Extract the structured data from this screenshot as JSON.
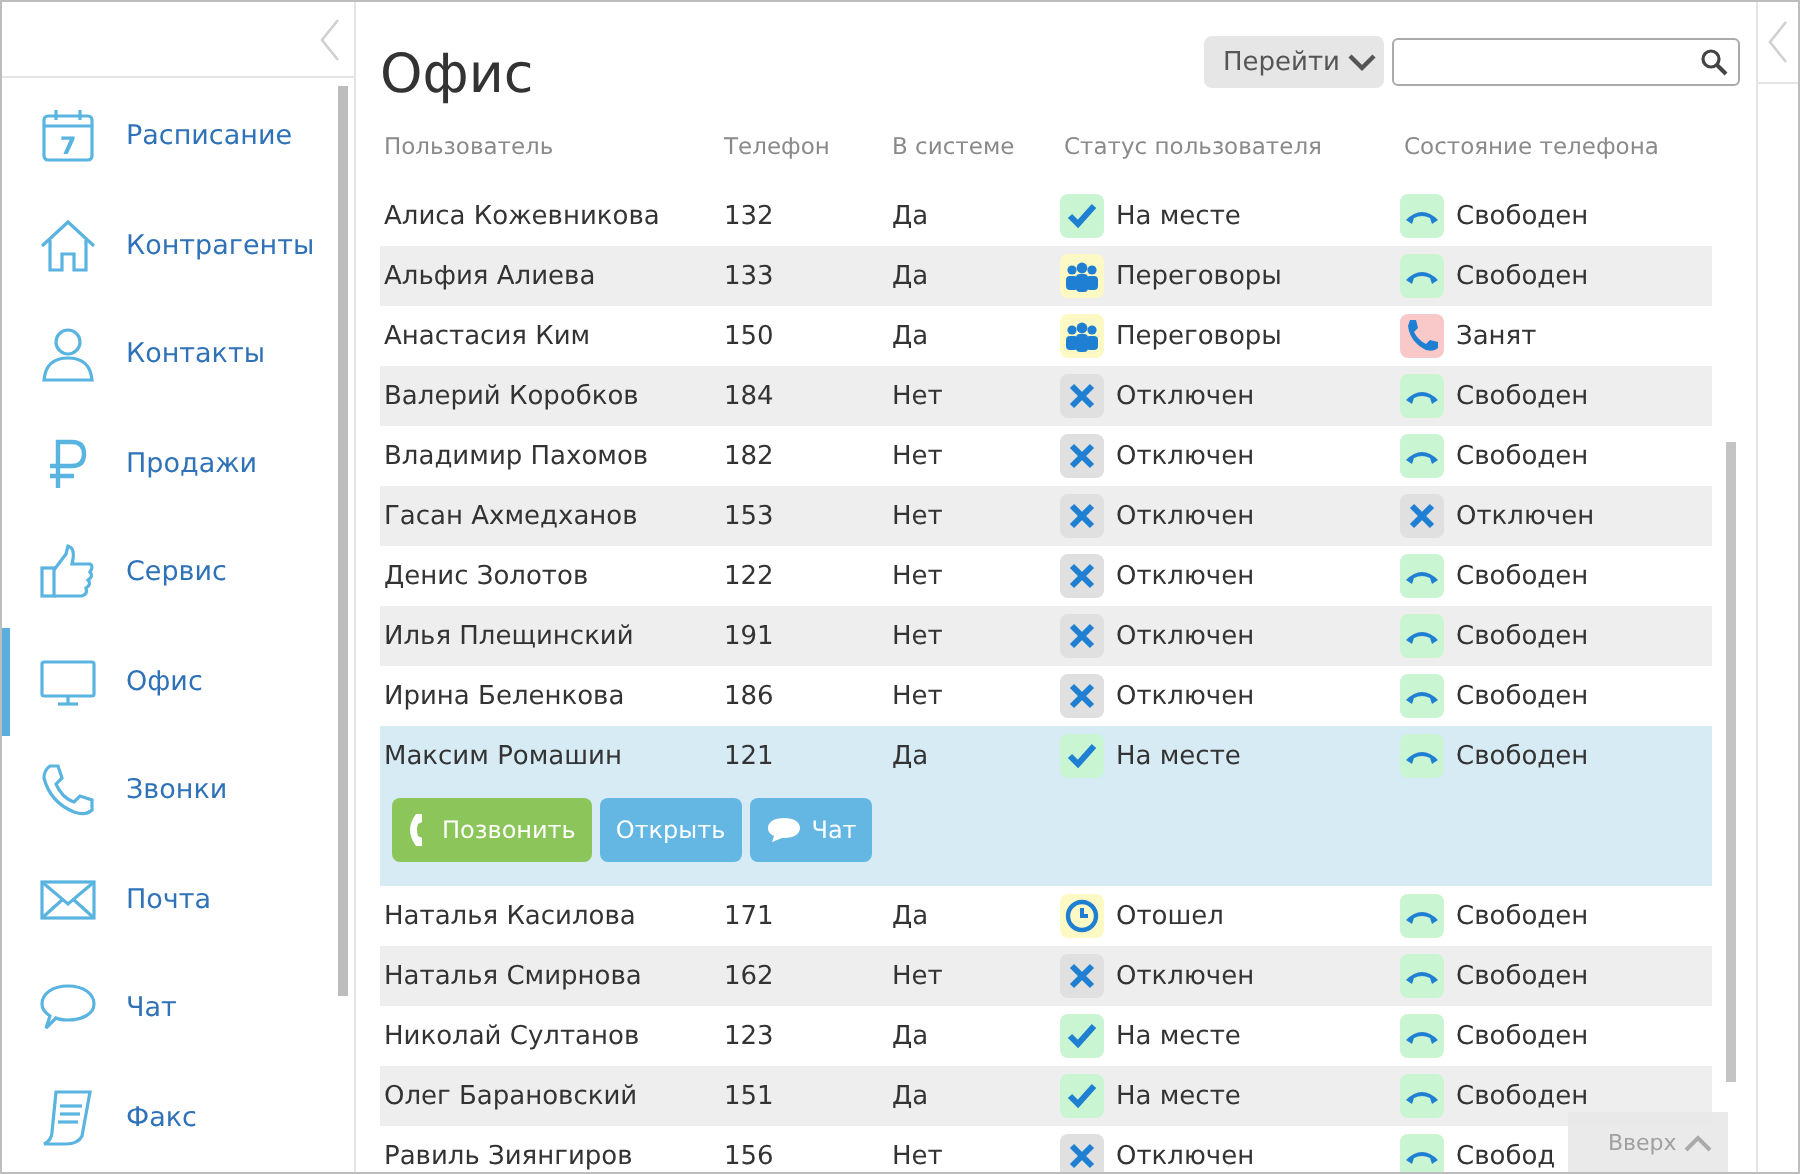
{
  "nav": {
    "items": [
      {
        "label": "Расписание",
        "kind": "calendar",
        "day": "7",
        "selected": false
      },
      {
        "label": "Контрагенты",
        "kind": "house",
        "selected": false
      },
      {
        "label": "Контакты",
        "kind": "person",
        "selected": false
      },
      {
        "label": "Продажи",
        "kind": "ruble",
        "selected": false
      },
      {
        "label": "Сервис",
        "kind": "thumb",
        "selected": false
      },
      {
        "label": "Офис",
        "kind": "monitor",
        "selected": true
      },
      {
        "label": "Звонки",
        "kind": "phone",
        "selected": false
      },
      {
        "label": "Почта",
        "kind": "mail",
        "selected": false
      },
      {
        "label": "Чат",
        "kind": "chat",
        "selected": false
      },
      {
        "label": "Факс",
        "kind": "fax",
        "selected": false
      }
    ]
  },
  "page": {
    "title": "Офис",
    "goto": "Перейти"
  },
  "table": {
    "columns": [
      "Пользователь",
      "Телефон",
      "В системе",
      "Статус пользователя",
      "Состояние телефона"
    ],
    "rows": [
      {
        "name": "Алиса Кожевникова",
        "phone": "132",
        "online": "Да",
        "status": {
          "kind": "present",
          "label": "На месте"
        },
        "line": {
          "kind": "free",
          "label": "Свободен"
        },
        "selected": false
      },
      {
        "name": "Альфия Алиева",
        "phone": "133",
        "online": "Да",
        "status": {
          "kind": "meeting",
          "label": "Переговоры"
        },
        "line": {
          "kind": "free",
          "label": "Свободен"
        },
        "selected": false
      },
      {
        "name": "Анастасия Ким",
        "phone": "150",
        "online": "Да",
        "status": {
          "kind": "meeting",
          "label": "Переговоры"
        },
        "line": {
          "kind": "busy",
          "label": "Занят"
        },
        "selected": false
      },
      {
        "name": "Валерий Коробков",
        "phone": "184",
        "online": "Нет",
        "status": {
          "kind": "off",
          "label": "Отключен"
        },
        "line": {
          "kind": "free",
          "label": "Свободен"
        },
        "selected": false
      },
      {
        "name": "Владимир Пахомов",
        "phone": "182",
        "online": "Нет",
        "status": {
          "kind": "off",
          "label": "Отключен"
        },
        "line": {
          "kind": "free",
          "label": "Свободен"
        },
        "selected": false
      },
      {
        "name": "Гасан Ахмедханов",
        "phone": "153",
        "online": "Нет",
        "status": {
          "kind": "off",
          "label": "Отключен"
        },
        "line": {
          "kind": "off",
          "label": "Отключен"
        },
        "selected": false
      },
      {
        "name": "Денис Золотов",
        "phone": "122",
        "online": "Нет",
        "status": {
          "kind": "off",
          "label": "Отключен"
        },
        "line": {
          "kind": "free",
          "label": "Свободен"
        },
        "selected": false
      },
      {
        "name": "Илья Плещинский",
        "phone": "191",
        "online": "Нет",
        "status": {
          "kind": "off",
          "label": "Отключен"
        },
        "line": {
          "kind": "free",
          "label": "Свободен"
        },
        "selected": false
      },
      {
        "name": "Ирина Беленкова",
        "phone": "186",
        "online": "Нет",
        "status": {
          "kind": "off",
          "label": "Отключен"
        },
        "line": {
          "kind": "free",
          "label": "Свободен"
        },
        "selected": false
      },
      {
        "name": "Максим Ромашин",
        "phone": "121",
        "online": "Да",
        "status": {
          "kind": "present",
          "label": "На месте"
        },
        "line": {
          "kind": "free",
          "label": "Свободен"
        },
        "selected": true
      },
      {
        "name": "Наталья Касилова",
        "phone": "171",
        "online": "Да",
        "status": {
          "kind": "away",
          "label": "Отошел"
        },
        "line": {
          "kind": "free",
          "label": "Свободен"
        },
        "selected": false
      },
      {
        "name": "Наталья Смирнова",
        "phone": "162",
        "online": "Нет",
        "status": {
          "kind": "off",
          "label": "Отключен"
        },
        "line": {
          "kind": "free",
          "label": "Свободен"
        },
        "selected": false
      },
      {
        "name": "Николай Султанов",
        "phone": "123",
        "online": "Да",
        "status": {
          "kind": "present",
          "label": "На месте"
        },
        "line": {
          "kind": "free",
          "label": "Свободен"
        },
        "selected": false
      },
      {
        "name": "Олег Барановский",
        "phone": "151",
        "online": "Да",
        "status": {
          "kind": "present",
          "label": "На месте"
        },
        "line": {
          "kind": "free",
          "label": "Свободен"
        },
        "selected": false
      },
      {
        "name": "Равиль Зиянгиров",
        "phone": "156",
        "online": "Нет",
        "status": {
          "kind": "off",
          "label": "Отключен"
        },
        "line": {
          "kind": "free",
          "label": "Свобод"
        },
        "selected": false
      }
    ],
    "row_actions": [
      {
        "label": "Позвонить",
        "kind": "call"
      },
      {
        "label": "Открыть",
        "kind": "open"
      },
      {
        "label": "Чат",
        "kind": "chat"
      }
    ]
  },
  "back_to_top": "Вверх"
}
